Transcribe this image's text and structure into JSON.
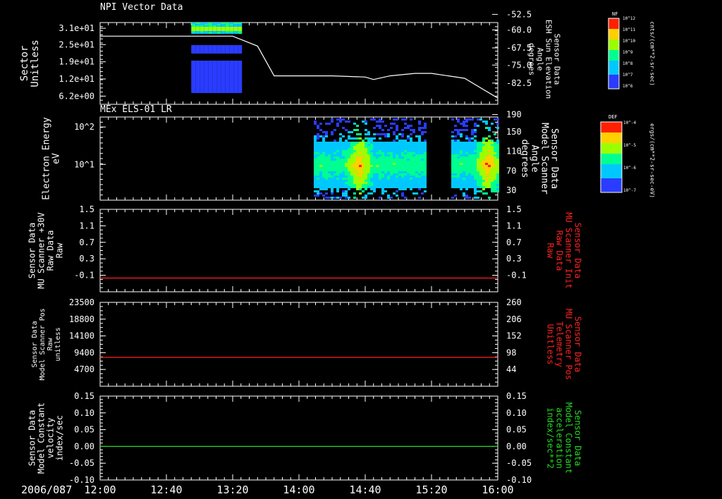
{
  "date_label": "2006/087",
  "time_ticks": [
    "12:00",
    "12:40",
    "13:20",
    "14:00",
    "14:40",
    "15:20",
    "16:00"
  ],
  "colors": {
    "red": "#ff2222",
    "green": "#22dd22",
    "white": "#ffffff",
    "bg": "#000000"
  },
  "chart_data": [
    {
      "type": "heatmap",
      "title": "NPI Vector Data",
      "ylabel": [
        "Sector",
        "Unitless"
      ],
      "y_ticks": [
        "3.1e+01",
        "2.5e+01",
        "1.9e+01",
        "1.2e+01",
        "6.2e+00"
      ],
      "y2_label": [
        "Sensor Data",
        "ESH Sun Elevation",
        "Angle",
        "degrees"
      ],
      "y2_ticks": [
        "-52.5",
        "-60.0",
        "-67.5",
        "-75.0",
        "-82.5"
      ],
      "colorbar": {
        "label": "NF",
        "unit": "cnts/(cm**2-sr-sec)",
        "ticks": [
          "10^12",
          "10^11",
          "10^10",
          "10^9",
          "10^8",
          "10^7",
          "10^6"
        ]
      },
      "line_series": {
        "name": "ESH Sun Elevation Angle",
        "x": [
          "12:00",
          "13:20",
          "13:35",
          "13:45",
          "14:20",
          "14:40",
          "14:45",
          "14:55",
          "15:10",
          "15:20",
          "15:40",
          "16:00"
        ],
        "y": [
          -58.0,
          -58.0,
          -62.0,
          -74.0,
          -74.0,
          -74.5,
          -75.5,
          -74.0,
          -73.0,
          -73.0,
          -75.0,
          -83.0
        ]
      }
    },
    {
      "type": "heatmap",
      "title": "MEx ELS-01 LR",
      "ylabel": [
        "Electron Energy",
        "eV"
      ],
      "y_ticks": [
        "10^2",
        "10^1"
      ],
      "y2_label": [
        "Sensor Data",
        "Model Scanner",
        "Angle",
        "degrees"
      ],
      "y2_ticks": [
        "190",
        "150",
        "110",
        "70",
        "30"
      ],
      "colorbar": {
        "label": "DEF",
        "unit": "ergs/(cm**2-sr-sec-eV)",
        "ticks": [
          "10^-4",
          "10^-5",
          "10^-6",
          "10^-7"
        ]
      },
      "data_intervals": [
        [
          "14:05",
          "14:50"
        ],
        [
          "15:20",
          "16:00"
        ]
      ]
    },
    {
      "type": "line",
      "ylabel": [
        "Sensor Data",
        "MU Scanner +30V",
        "Raw Data",
        "Raw"
      ],
      "y_ticks": [
        "1.5",
        "1.1",
        "0.7",
        "0.3",
        "-0.1"
      ],
      "y2_label": [
        "Sensor Data",
        "MU Scanner Init",
        "Raw Data",
        "Raw"
      ],
      "y2_ticks": [
        "1.5",
        "1.1",
        "0.7",
        "0.3",
        "-0.1"
      ],
      "ylim": [
        -0.3,
        1.5
      ],
      "series": [
        {
          "x": [
            "12:00",
            "16:00"
          ],
          "values": [
            0.0,
            0.0
          ]
        }
      ]
    },
    {
      "type": "line",
      "ylabel": [
        "Sensor Data",
        "Model Scanner Pos",
        "Raw",
        "unitless"
      ],
      "y_ticks": [
        "23500",
        "18800",
        "14100",
        "9400",
        "4700"
      ],
      "y2_label": [
        "Sensor Data",
        "MU Scanner Pos",
        "Telemetry",
        "Unitless"
      ],
      "y2_ticks": [
        "260",
        "206",
        "152",
        "98",
        "44"
      ],
      "ylim": [
        0,
        23500
      ],
      "series": [
        {
          "x": [
            "12:00",
            "16:00"
          ],
          "values": [
            8100,
            8100
          ]
        }
      ]
    },
    {
      "type": "line",
      "ylabel": [
        "Sensor Data",
        "Model Constant",
        "velocity",
        "index/sec"
      ],
      "y_ticks": [
        "0.15",
        "0.10",
        "0.05",
        "0.00",
        "-0.05",
        "-0.10"
      ],
      "y2_label": [
        "Sensor Data",
        "Model Constant",
        "acceleration",
        "index/sec**2"
      ],
      "y2_ticks": [
        "0.15",
        "0.10",
        "0.05",
        "0.00",
        "-0.05",
        "-0.10"
      ],
      "ylim": [
        -0.1,
        0.15
      ],
      "series": [
        {
          "x": [
            "12:00",
            "16:00"
          ],
          "values": [
            0.0,
            0.0
          ]
        }
      ]
    }
  ]
}
